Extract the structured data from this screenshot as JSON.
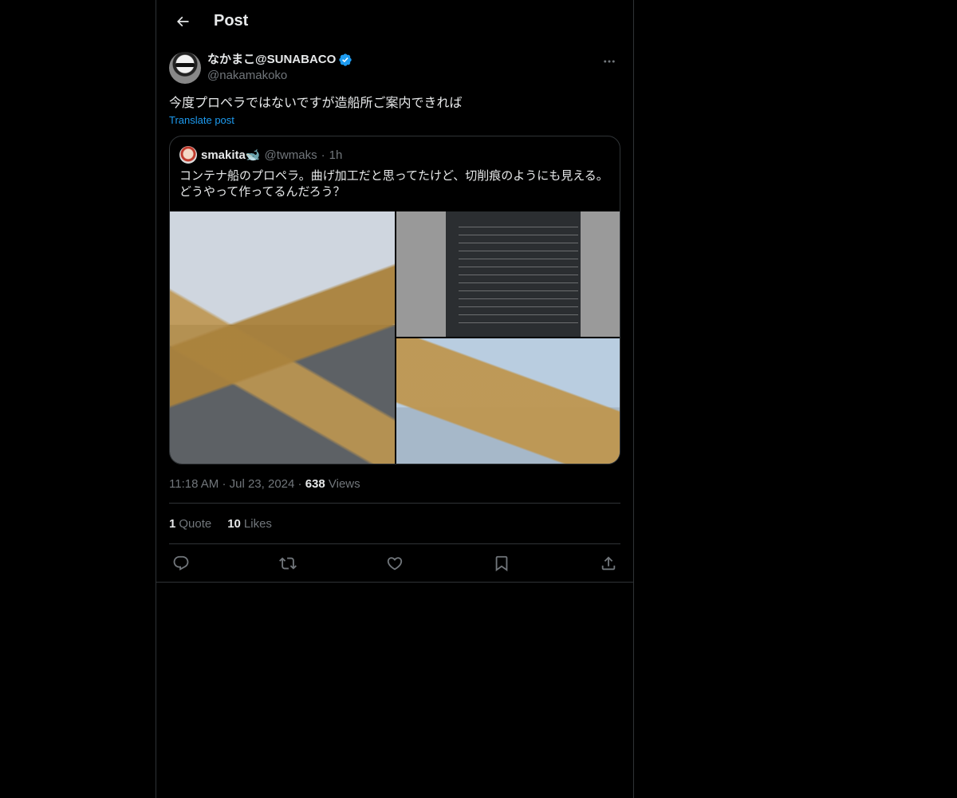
{
  "header": {
    "title": "Post"
  },
  "post": {
    "author_name": "なかまこ@SUNABACO",
    "author_handle": "@nakamakoko",
    "text": "今度プロペラではないですが造船所ご案内できれば",
    "translate_label": "Translate post",
    "time": "11:18 AM",
    "date": "Jul 23, 2024",
    "views_count": "638",
    "views_label": "Views",
    "quotes_count": "1",
    "quotes_label": "Quote",
    "likes_count": "10",
    "likes_label": "Likes"
  },
  "quote": {
    "name": "smakita🐋",
    "handle": "@twmaks",
    "time": "1h",
    "text_line1": "コンテナ船のプロペラ。曲げ加工だと思ってたけど、切削痕のようにも見える。",
    "text_line2": "どうやって作ってるんだろう？"
  },
  "colors": {
    "background": "#000000",
    "text": "#e7e9ea",
    "secondary": "#71767b",
    "accent": "#1d9bf0",
    "border": "#2f3336"
  },
  "icons": [
    "back-arrow-icon",
    "verified-badge-icon",
    "more-icon",
    "reply-icon",
    "repost-icon",
    "like-icon",
    "bookmark-icon",
    "share-icon"
  ]
}
